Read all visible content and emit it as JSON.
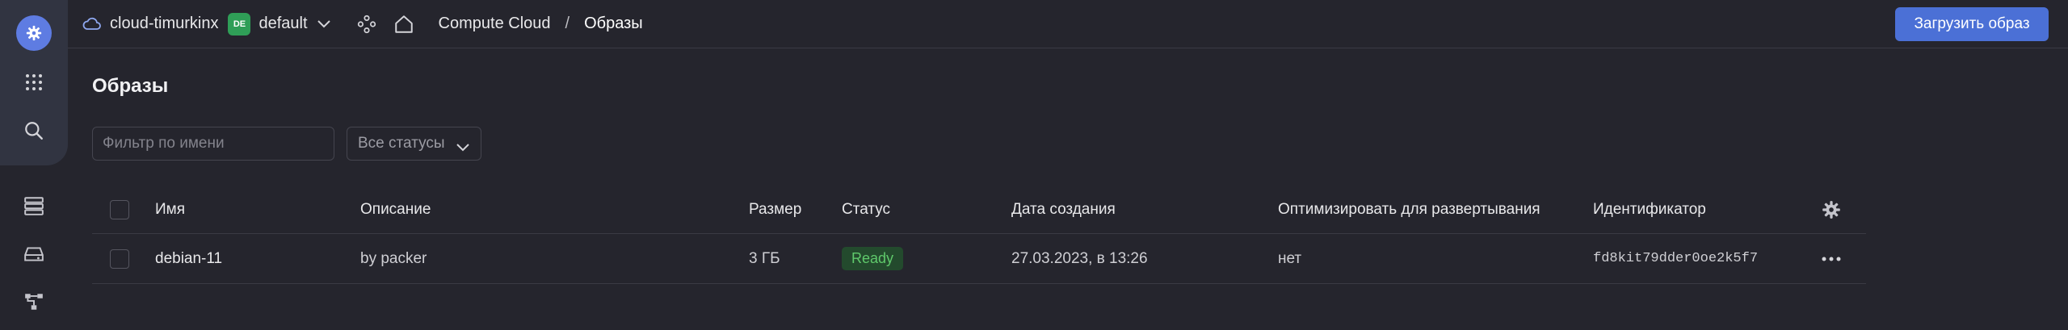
{
  "header": {
    "cloud_name": "cloud-timurkinx",
    "folder_badge": "DE",
    "folder_name": "default",
    "breadcrumb_service": "Compute Cloud",
    "breadcrumb_sep": "/",
    "breadcrumb_current": "Образы",
    "upload_button": "Загрузить образ"
  },
  "sidebar": {
    "items": [
      {
        "icon": "gear-icon"
      },
      {
        "icon": "grid-icon"
      },
      {
        "icon": "search-icon"
      },
      {
        "icon": "database-icon"
      },
      {
        "icon": "disk-icon"
      },
      {
        "icon": "network-icon"
      }
    ]
  },
  "main": {
    "title": "Образы",
    "filter_placeholder": "Фильтр по имени",
    "status_filter": "Все статусы",
    "columns": {
      "name": "Имя",
      "description": "Описание",
      "size": "Размер",
      "status": "Статус",
      "created": "Дата создания",
      "optimize": "Оптимизировать для развертывания",
      "id": "Идентификатор"
    },
    "rows": [
      {
        "name": "debian-11",
        "description": "by packer",
        "size": "3 ГБ",
        "status": "Ready",
        "created": "27.03.2023, в 13:26",
        "optimize": "нет",
        "id": "fd8kit79dder0oe2k5f7"
      }
    ]
  },
  "colors": {
    "accent": "#4b70d6",
    "status_ready": "#5fc96b",
    "background": "#25252d"
  }
}
